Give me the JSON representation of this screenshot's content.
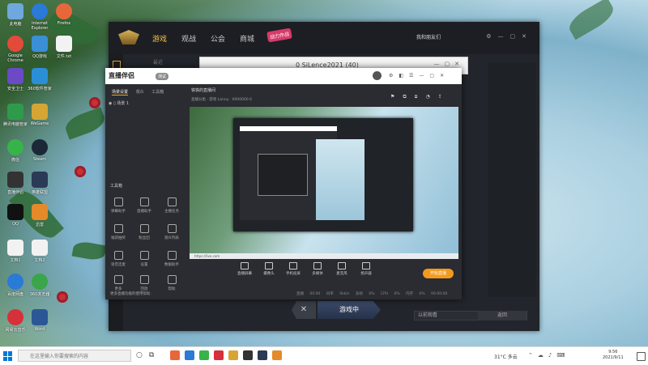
{
  "desktop": {
    "icons": [
      {
        "label": "此电脑",
        "color": "#6fa8dc"
      },
      {
        "label": "Internet Explorer",
        "color": "#2a7ad6"
      },
      {
        "label": "Firefox",
        "color": "#e8673a"
      },
      {
        "label": "Google Chrome",
        "color": "#e44a3a"
      },
      {
        "label": "QQ游戏",
        "color": "#3a8fd6"
      },
      {
        "label": "文件.txt",
        "color": "#f2f2f2"
      },
      {
        "label": "安全卫士",
        "color": "#6b4ac6"
      },
      {
        "label": "360软件管家",
        "color": "#2a8fd6"
      },
      {
        "label": "腾讯电脑管家",
        "color": "#2e9b4a"
      },
      {
        "label": "WeGame",
        "color": "#d6a534"
      },
      {
        "label": "微信",
        "color": "#38b34a"
      },
      {
        "label": "Steam",
        "color": "#1b2838"
      },
      {
        "label": "直播伴侣",
        "color": "#333333"
      },
      {
        "label": "英雄联盟",
        "color": "#2b3a55"
      },
      {
        "label": "QQ",
        "color": "#111111"
      },
      {
        "label": "迅雷",
        "color": "#e48a2a"
      },
      {
        "label": "文档1",
        "color": "#f2f2f2"
      },
      {
        "label": "文档2",
        "color": "#f2f2f2"
      },
      {
        "label": "百度网盘",
        "color": "#2a7ad6"
      },
      {
        "label": "360浏览器",
        "color": "#3aa54a"
      },
      {
        "label": "网易云音乐",
        "color": "#d6303a"
      },
      {
        "label": "Word",
        "color": "#2b5797"
      }
    ]
  },
  "main_window": {
    "tabs": [
      {
        "label": "游戏",
        "active": true
      },
      {
        "label": "观战",
        "active": false
      },
      {
        "label": "公会",
        "active": false
      },
      {
        "label": "商城",
        "active": false
      }
    ],
    "badge": "战力作战",
    "user": "我和朋友们",
    "subnav": "最近",
    "bottom_input": "以前观看",
    "bottom_button": "返回",
    "play_cancel": "✕",
    "play_label": "游戏中"
  },
  "mid_window": {
    "title": "0 SiLence2021 (40)"
  },
  "streaming_app": {
    "logo": "直播伴侣",
    "version": "测试",
    "tabs": [
      {
        "label": "场景设置",
        "active": true
      },
      {
        "label": "观众",
        "active": false
      },
      {
        "label": "工具箱",
        "active": false
      }
    ],
    "scene": "场景 1",
    "stream_title": "铁铁的直播间",
    "stream_meta": "直播分类 · 游戏   Lanny · 0000000   6",
    "tools_title": "工具箱",
    "tools": [
      {
        "label": "弹幕助手"
      },
      {
        "label": "直播助手"
      },
      {
        "label": "主播任务"
      },
      {
        "label": "福袋抽奖"
      },
      {
        "label": "粉丝团"
      },
      {
        "label": "观众列表"
      },
      {
        "label": "语音连麦"
      },
      {
        "label": "设置"
      },
      {
        "label": "数据助手"
      },
      {
        "label": "更多"
      },
      {
        "label": "回放"
      },
      {
        "label": "帮助"
      }
    ],
    "bottom_left": "更多直播功能的使用帮助",
    "actions": [
      {
        "label": "直播屏幕"
      },
      {
        "label": "摄像头"
      },
      {
        "label": "手机投屏"
      },
      {
        "label": "多媒体"
      },
      {
        "label": "麦克风"
      },
      {
        "label": "扬声器"
      }
    ],
    "start_button": "开始直播",
    "footer": [
      "直播 00:00",
      "码率 0kb/s",
      "丢帧 0%",
      "CPU 0%",
      "内存 0%",
      "00:00:00"
    ],
    "preview_status": "https://live.com"
  },
  "taskbar": {
    "search_placeholder": "在这里输入你要搜索的内容",
    "weather": "31°C 多云",
    "time": "9:56",
    "date": "2021/9/11",
    "apps": [
      {
        "color": "#e8673a"
      },
      {
        "color": "#2a7ad6"
      },
      {
        "color": "#38b34a"
      },
      {
        "color": "#d6303a"
      },
      {
        "color": "#d6a534"
      },
      {
        "color": "#333333"
      },
      {
        "color": "#2b3a55"
      },
      {
        "color": "#e48a2a"
      }
    ]
  }
}
